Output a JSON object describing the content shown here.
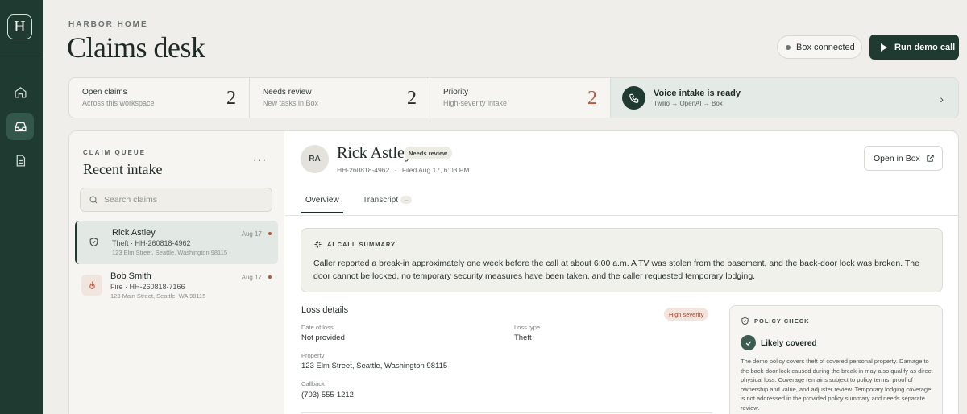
{
  "app": {
    "logo_letter": "H",
    "brand": "HARBOR HOME",
    "title": "Claims desk"
  },
  "header": {
    "box_status": "Box connected",
    "run_label": "Run demo call"
  },
  "stats": [
    {
      "label": "Open claims",
      "sub": "Across this workspace",
      "value": "2"
    },
    {
      "label": "Needs review",
      "sub": "New tasks in Box",
      "value": "2"
    },
    {
      "label": "Priority",
      "sub": "High-severity intake",
      "value": "2"
    }
  ],
  "voice": {
    "title": "Voice intake is ready",
    "sub": "Twilio → OpenAI → Box"
  },
  "queue": {
    "kicker": "CLAIM QUEUE",
    "title": "Recent intake",
    "more": "···",
    "search_placeholder": "Search claims",
    "items": [
      {
        "name": "Rick Astley",
        "type": "Theft · HH-260818-4962",
        "address": "123 Elm Street, Seattle, Washington 98115",
        "date": "Aug 17",
        "icon": "shield-icon"
      },
      {
        "name": "Bob Smith",
        "type": "Fire · HH-260818-7166",
        "address": "123 Main Street, Seattle, WA 98115",
        "date": "Aug 17",
        "icon": "flame-icon"
      }
    ]
  },
  "detail": {
    "initials": "RA",
    "name": "Rick Astley",
    "badge": "Needs review",
    "claim_id": "HH-260818-4962",
    "sep": "·",
    "filed": "Filed Aug 17, 6:03 PM",
    "open_box": "Open in Box",
    "tabs": {
      "overview": "Overview",
      "transcript": "Transcript",
      "transcript_pill": "..."
    },
    "summary": {
      "heading": "AI CALL SUMMARY",
      "text": "Caller reported a break-in approximately one week before the call at about 6:00 a.m. A TV was stolen from the basement, and the back-door lock was broken. The door cannot be locked, no temporary security measures have been taken, and the caller requested temporary lodging."
    },
    "loss": {
      "heading": "Loss details",
      "severity": "High severity",
      "date_label": "Date of loss",
      "date_value": "Not provided",
      "type_label": "Loss type",
      "type_value": "Theft",
      "property_label": "Property",
      "property_value": "123 Elm Street, Seattle, Washington 98115",
      "callback_label": "Callback",
      "callback_value": "(703) 555-1212"
    },
    "policy": {
      "heading": "POLICY CHECK",
      "result": "Likely covered",
      "text": "The demo policy covers theft of covered personal property. Damage to the back-door lock caused during the break-in may also qualify as direct physical loss. Coverage remains subject to policy terms, proof of ownership and value, and adjuster review. Temporary lodging coverage is not addressed in the provided policy summary and needs separate review."
    }
  },
  "colors": {
    "sidebar": "#1f3a31",
    "accent": "#1f3a31",
    "priority": "#b9573d",
    "background": "#efeeea"
  }
}
